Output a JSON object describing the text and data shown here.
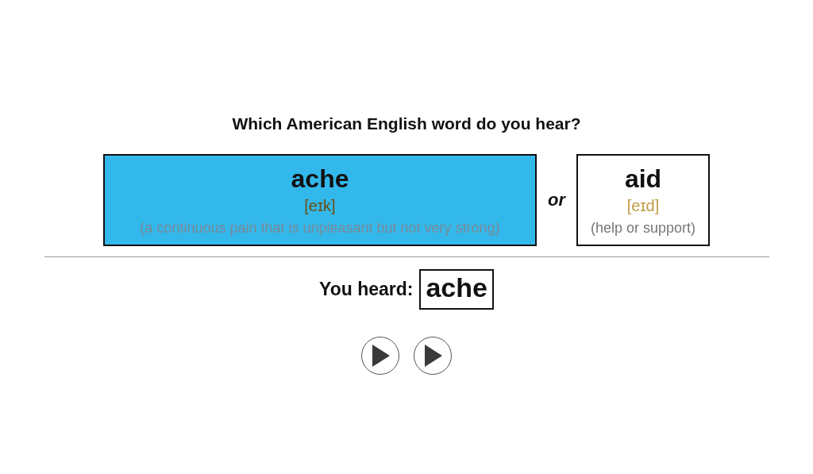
{
  "question": "Which American English word do you hear?",
  "options": [
    {
      "word": "ache",
      "ipa": "[eɪk]",
      "gloss": "(a continuous pain that is unpleasant but not very strong)",
      "selected": true
    },
    {
      "word": "aid",
      "ipa": "[eɪd]",
      "gloss": "(help or support)",
      "selected": false
    }
  ],
  "separator": "or",
  "result": {
    "label": "You heard:",
    "word": "ache"
  },
  "play_buttons": [
    {
      "kind": "play"
    },
    {
      "kind": "play"
    }
  ]
}
